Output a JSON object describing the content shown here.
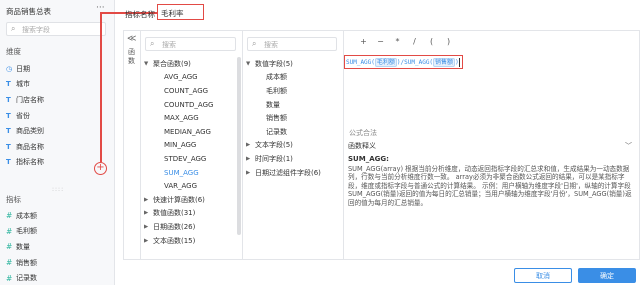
{
  "sidebar": {
    "title": "商品销售总表",
    "more": "···",
    "search_placeholder": "搜索字段",
    "dimension_label": "维度",
    "dimensions": [
      {
        "icon": "calendar-icon",
        "glyph": "◷",
        "label": "日期"
      },
      {
        "icon": "text-type-icon",
        "glyph": "T",
        "label": "城市"
      },
      {
        "icon": "text-type-icon",
        "glyph": "T",
        "label": "门店名称"
      },
      {
        "icon": "text-type-icon",
        "glyph": "T",
        "label": "省份"
      },
      {
        "icon": "text-type-icon",
        "glyph": "T",
        "label": "商品类别"
      },
      {
        "icon": "text-type-icon",
        "glyph": "T",
        "label": "商品名称"
      },
      {
        "icon": "text-type-icon",
        "glyph": "T",
        "label": "指标名称"
      }
    ],
    "metric_label": "指标",
    "add_glyph": "+",
    "drag_glyph": "::::",
    "metrics": [
      {
        "icon": "hash-icon",
        "glyph": "#",
        "label": "成本额"
      },
      {
        "icon": "hash-icon",
        "glyph": "#",
        "label": "毛利额"
      },
      {
        "icon": "hash-icon",
        "glyph": "#",
        "label": "数量"
      },
      {
        "icon": "hash-icon",
        "glyph": "#",
        "label": "销售额"
      },
      {
        "icon": "hash-icon",
        "glyph": "#",
        "label": "记录数"
      }
    ]
  },
  "header": {
    "name_label": "指标名称",
    "name_value": "毛利率"
  },
  "panel": {
    "collapse_glyph": "≪",
    "vertical_tab": "函数",
    "functions": {
      "search_placeholder": "搜索",
      "groups": [
        {
          "label": "聚合函数(9)",
          "expanded": true,
          "items": [
            "AVG_AGG",
            "COUNT_AGG",
            "COUNTD_AGG",
            "MAX_AGG",
            "MEDIAN_AGG",
            "MIN_AGG",
            "STDEV_AGG",
            "SUM_AGG",
            "VAR_AGG"
          ],
          "active": "SUM_AGG"
        },
        {
          "label": "快速计算函数(6)",
          "expanded": false
        },
        {
          "label": "数值函数(31)",
          "expanded": false
        },
        {
          "label": "日期函数(26)",
          "expanded": false
        },
        {
          "label": "文本函数(15)",
          "expanded": false
        }
      ]
    },
    "fields": {
      "search_placeholder": "搜索",
      "groups": [
        {
          "label": "数值字段(5)",
          "expanded": true,
          "items": [
            "成本额",
            "毛利额",
            "数量",
            "销售额",
            "记录数"
          ]
        },
        {
          "label": "文本字段(5)",
          "expanded": false
        },
        {
          "label": "时间字段(1)",
          "expanded": false
        },
        {
          "label": "日期过滤组件字段(6)",
          "expanded": false
        }
      ]
    },
    "operators": [
      "+",
      "−",
      "*",
      "/",
      "(",
      ")"
    ],
    "formula": {
      "fn": "SUM_AGG(",
      "field1": "毛利额",
      "mid": ")/SUM_AGG(",
      "field2": "销售额",
      "end": ")"
    },
    "syntax_label": "公式合法",
    "explain_label": "函数释义",
    "explain_chevron": "﹀",
    "explain_fn": "SUM_AGG:",
    "explain_text": "SUM_AGG(array) 根据当前分析维度，动态返回指标字段的汇总求和值，生成结果为一动态数据列，行数与当前分析维度行数一致。 array必须为非聚合函数公式返回的结果，可以是某指标字段，维度或指标字段与普通公式的计算结果。 示例：用户横轴为维度字段'日期'，纵轴的计算字段SUM_AGG(销量)返回的值为每日的汇总销量；当用户横轴为维度字段'月份'，SUM_AGG(销量)返回的值为每月的汇总销量。"
  },
  "footer": {
    "cancel": "取消",
    "ok": "确定"
  },
  "colors": {
    "accent": "#3a8ee6",
    "annotation": "#e24a45",
    "metric_icon": "#2fb59f"
  }
}
